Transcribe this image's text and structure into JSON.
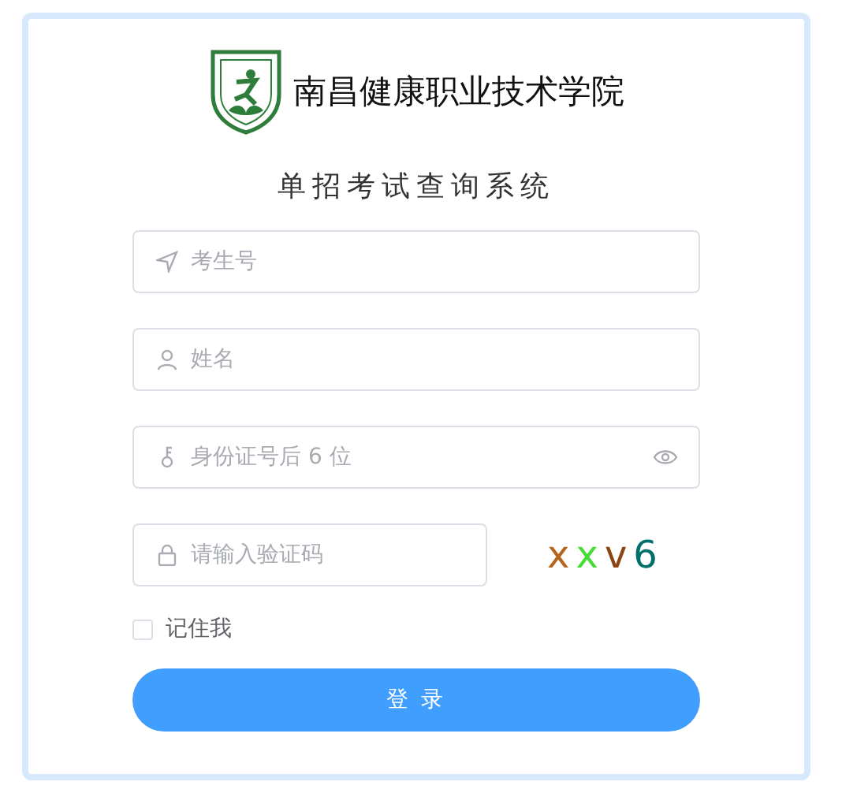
{
  "header": {
    "school_name": "南昌健康职业技术学院",
    "system_title": "单招考试查询系统"
  },
  "fields": [
    {
      "kind": "text",
      "placeholder": "考生号"
    },
    {
      "kind": "text",
      "placeholder": "姓名"
    },
    {
      "kind": "password",
      "placeholder": "身份证号后 6 位"
    },
    {
      "kind": "captcha",
      "placeholder": "请输入验证码"
    }
  ],
  "captcha": {
    "characters": [
      {
        "char": "x",
        "color": "#b5651d"
      },
      {
        "char": "x",
        "color": "#44dd33"
      },
      {
        "char": "v",
        "color": "#8b4513"
      },
      {
        "char": "6",
        "color": "#00706a"
      }
    ]
  },
  "remember": {
    "label": "记住我",
    "checked": false
  },
  "login_button": "登 录"
}
